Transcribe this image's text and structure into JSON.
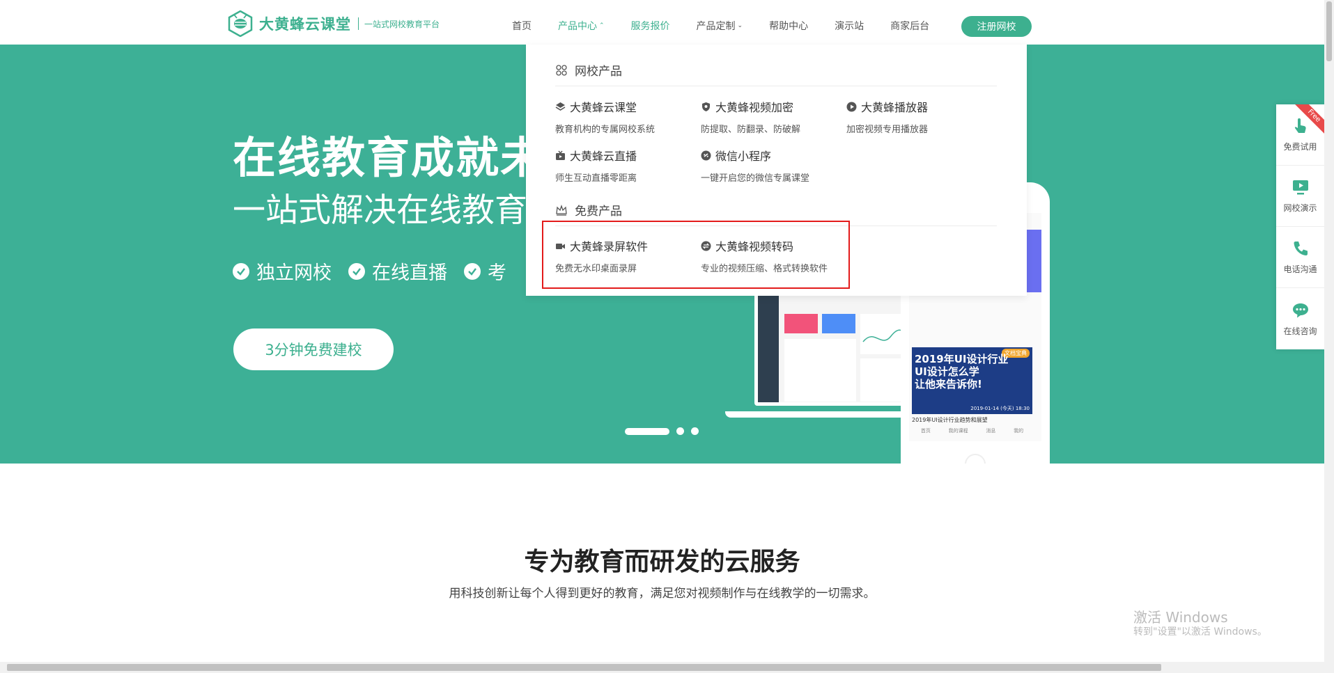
{
  "header": {
    "logo_name": "大黄蜂云课堂",
    "logo_slogan": "一站式网校教育平台",
    "nav": [
      {
        "label": "首页"
      },
      {
        "label": "产品中心",
        "caret": "⌃"
      },
      {
        "label": "服务报价"
      },
      {
        "label": "产品定制",
        "caret": "⌄"
      },
      {
        "label": "帮助中心"
      },
      {
        "label": "演示站"
      },
      {
        "label": "商家后台"
      }
    ],
    "register_label": "注册网校",
    "brand_color": "#3db08f"
  },
  "hero": {
    "title": "在线教育成就未",
    "subtitle": "一站式解决在线教育",
    "features": [
      {
        "label": "独立网校"
      },
      {
        "label": "在线直播"
      },
      {
        "label": "考"
      }
    ],
    "cta_label": "3分钟免费建校",
    "background": "#3db096",
    "phone_banner_tag": "文档宝典",
    "phone_banner_title_1": "2019年UI设计行业",
    "phone_banner_title_2": "UI设计怎么学",
    "phone_banner_title_3": "让他来告诉你!",
    "phone_banner_date": "2019-01-14 (今天) 18:30",
    "phone_caption": "2019年UI设计行业趋势和展望",
    "phone_tabs": [
      "首页",
      "我的课程",
      "消息",
      "我的"
    ]
  },
  "dropdown": {
    "section1_title": "网校产品",
    "section2_title": "免费产品",
    "products": [
      {
        "name": "大黄蜂云课堂",
        "desc": "教育机构的专属网校系统",
        "icon": "layers-icon"
      },
      {
        "name": "大黄蜂视频加密",
        "desc": "防提取、防翻录、防破解",
        "icon": "shield-icon"
      },
      {
        "name": "大黄蜂播放器",
        "desc": "加密视频专用播放器",
        "icon": "play-icon"
      },
      {
        "name": "大黄蜂云直播",
        "desc": "师生互动直播零距离",
        "icon": "tv-icon"
      },
      {
        "name": "微信小程序",
        "desc": "一键开启您的微信专属课堂",
        "icon": "link-icon"
      }
    ],
    "free_products": [
      {
        "name": "大黄蜂录屏软件",
        "desc": "免费无水印桌面录屏",
        "icon": "camera-icon"
      },
      {
        "name": "大黄蜂视频转码",
        "desc": "专业的视频压缩、格式转换软件",
        "icon": "convert-icon"
      }
    ],
    "highlight_color": "#e31b1b"
  },
  "floatbar": {
    "free_badge": "Free",
    "items": [
      {
        "label": "免费试用",
        "icon": "hand-icon"
      },
      {
        "label": "网校演示",
        "icon": "monitor-icon"
      },
      {
        "label": "电话沟通",
        "icon": "phone-icon"
      },
      {
        "label": "在线咨询",
        "icon": "chat-icon"
      }
    ]
  },
  "section": {
    "title": "专为教育而研发的云服务",
    "subtitle": "用科技创新让每个人得到更好的教育，满足您对视频制作与在线教学的一切需求。"
  },
  "watermark": {
    "line1": "激活 Windows",
    "line2": "转到\"设置\"以激活 Windows。"
  }
}
